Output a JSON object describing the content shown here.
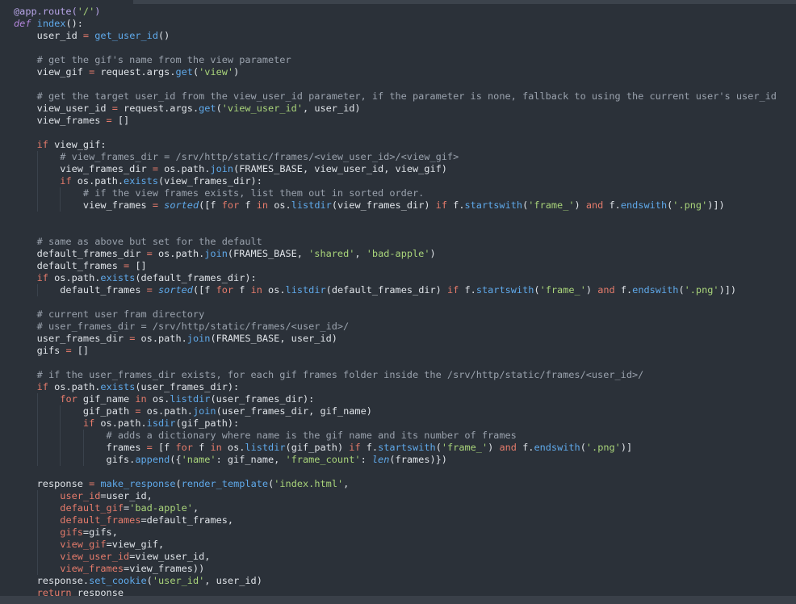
{
  "editor": {
    "language": "python",
    "colors": {
      "background": "#2b3139",
      "text": "#dfe3e8",
      "keyword": "#c678dd",
      "keyword_alt": "#e57b6b",
      "function": "#5fa9ea",
      "string": "#a9d47a",
      "comment": "#9aa2ad"
    },
    "lines": [
      [
        {
          "t": "@app.route(",
          "c": "t-dec"
        },
        {
          "t": "'/'",
          "c": "t-str"
        },
        {
          "t": ")",
          "c": "t-dec"
        }
      ],
      [
        {
          "t": "def",
          "c": "t-def"
        },
        {
          "t": " "
        },
        {
          "t": "index",
          "c": "t-fn"
        },
        {
          "t": "():"
        }
      ],
      [
        {
          "t": "    user_id "
        },
        {
          "t": "=",
          "c": "t-op"
        },
        {
          "t": " "
        },
        {
          "t": "get_user_id",
          "c": "t-fn"
        },
        {
          "t": "()"
        }
      ],
      [],
      [
        {
          "t": "    "
        },
        {
          "t": "# get the gif's name from the view parameter",
          "c": "t-cm"
        }
      ],
      [
        {
          "t": "    view_gif "
        },
        {
          "t": "=",
          "c": "t-op"
        },
        {
          "t": " request.args."
        },
        {
          "t": "get",
          "c": "t-fn"
        },
        {
          "t": "("
        },
        {
          "t": "'view'",
          "c": "t-str"
        },
        {
          "t": ")"
        }
      ],
      [],
      [
        {
          "t": "    "
        },
        {
          "t": "# get the target user_id from the view_user_id parameter, if the parameter is none, fallback to using the current user's user_id",
          "c": "t-cm"
        }
      ],
      [
        {
          "t": "    view_user_id "
        },
        {
          "t": "=",
          "c": "t-op"
        },
        {
          "t": " request.args."
        },
        {
          "t": "get",
          "c": "t-fn"
        },
        {
          "t": "("
        },
        {
          "t": "'view_user_id'",
          "c": "t-str"
        },
        {
          "t": ", user_id)"
        }
      ],
      [
        {
          "t": "    view_frames "
        },
        {
          "t": "=",
          "c": "t-op"
        },
        {
          "t": " []"
        }
      ],
      [],
      [
        {
          "t": "    "
        },
        {
          "t": "if",
          "c": "t-kw2"
        },
        {
          "t": " view_gif:"
        }
      ],
      [
        {
          "t": "        "
        },
        {
          "t": "# view_frames_dir = /srv/http/static/frames/<view_user_id>/<view_gif>",
          "c": "t-cm"
        }
      ],
      [
        {
          "t": "        view_frames_dir "
        },
        {
          "t": "=",
          "c": "t-op"
        },
        {
          "t": " os.path."
        },
        {
          "t": "join",
          "c": "t-fn"
        },
        {
          "t": "(FRAMES_BASE, view_user_id, view_gif)"
        }
      ],
      [
        {
          "t": "        "
        },
        {
          "t": "if",
          "c": "t-kw2"
        },
        {
          "t": " os.path."
        },
        {
          "t": "exists",
          "c": "t-fn"
        },
        {
          "t": "(view_frames_dir):"
        }
      ],
      [
        {
          "t": "            "
        },
        {
          "t": "# if the view frames exists, list them out in sorted order.",
          "c": "t-cm"
        }
      ],
      [
        {
          "t": "            view_frames "
        },
        {
          "t": "=",
          "c": "t-op"
        },
        {
          "t": " "
        },
        {
          "t": "sorted",
          "c": "t-bi"
        },
        {
          "t": "([f "
        },
        {
          "t": "for",
          "c": "t-kw2"
        },
        {
          "t": " f "
        },
        {
          "t": "in",
          "c": "t-kw2"
        },
        {
          "t": " os."
        },
        {
          "t": "listdir",
          "c": "t-fn"
        },
        {
          "t": "(view_frames_dir) "
        },
        {
          "t": "if",
          "c": "t-kw2"
        },
        {
          "t": " f."
        },
        {
          "t": "startswith",
          "c": "t-fn"
        },
        {
          "t": "("
        },
        {
          "t": "'frame_'",
          "c": "t-str"
        },
        {
          "t": ") "
        },
        {
          "t": "and",
          "c": "t-kw2"
        },
        {
          "t": " f."
        },
        {
          "t": "endswith",
          "c": "t-fn"
        },
        {
          "t": "("
        },
        {
          "t": "'.png'",
          "c": "t-str"
        },
        {
          "t": ")])"
        }
      ],
      [],
      [],
      [
        {
          "t": "    "
        },
        {
          "t": "# same as above but set for the default",
          "c": "t-cm"
        }
      ],
      [
        {
          "t": "    default_frames_dir "
        },
        {
          "t": "=",
          "c": "t-op"
        },
        {
          "t": " os.path."
        },
        {
          "t": "join",
          "c": "t-fn"
        },
        {
          "t": "(FRAMES_BASE, "
        },
        {
          "t": "'shared'",
          "c": "t-str"
        },
        {
          "t": ", "
        },
        {
          "t": "'bad-apple'",
          "c": "t-str"
        },
        {
          "t": ")"
        }
      ],
      [
        {
          "t": "    default_frames "
        },
        {
          "t": "=",
          "c": "t-op"
        },
        {
          "t": " []"
        }
      ],
      [
        {
          "t": "    "
        },
        {
          "t": "if",
          "c": "t-kw2"
        },
        {
          "t": " os.path."
        },
        {
          "t": "exists",
          "c": "t-fn"
        },
        {
          "t": "(default_frames_dir):"
        }
      ],
      [
        {
          "t": "        default_frames "
        },
        {
          "t": "=",
          "c": "t-op"
        },
        {
          "t": " "
        },
        {
          "t": "sorted",
          "c": "t-bi"
        },
        {
          "t": "([f "
        },
        {
          "t": "for",
          "c": "t-kw2"
        },
        {
          "t": " f "
        },
        {
          "t": "in",
          "c": "t-kw2"
        },
        {
          "t": " os."
        },
        {
          "t": "listdir",
          "c": "t-fn"
        },
        {
          "t": "(default_frames_dir) "
        },
        {
          "t": "if",
          "c": "t-kw2"
        },
        {
          "t": " f."
        },
        {
          "t": "startswith",
          "c": "t-fn"
        },
        {
          "t": "("
        },
        {
          "t": "'frame_'",
          "c": "t-str"
        },
        {
          "t": ") "
        },
        {
          "t": "and",
          "c": "t-kw2"
        },
        {
          "t": " f."
        },
        {
          "t": "endswith",
          "c": "t-fn"
        },
        {
          "t": "("
        },
        {
          "t": "'.png'",
          "c": "t-str"
        },
        {
          "t": ")])"
        }
      ],
      [],
      [
        {
          "t": "    "
        },
        {
          "t": "# current user fram directory",
          "c": "t-cm"
        }
      ],
      [
        {
          "t": "    "
        },
        {
          "t": "# user_frames_dir = /srv/http/static/frames/<user_id>/",
          "c": "t-cm"
        }
      ],
      [
        {
          "t": "    user_frames_dir "
        },
        {
          "t": "=",
          "c": "t-op"
        },
        {
          "t": " os.path."
        },
        {
          "t": "join",
          "c": "t-fn"
        },
        {
          "t": "(FRAMES_BASE, user_id)"
        }
      ],
      [
        {
          "t": "    gifs "
        },
        {
          "t": "=",
          "c": "t-op"
        },
        {
          "t": " []"
        }
      ],
      [],
      [
        {
          "t": "    "
        },
        {
          "t": "# if the user_frames_dir exists, for each gif frames folder inside the /srv/http/static/frames/<user_id>/",
          "c": "t-cm"
        }
      ],
      [
        {
          "t": "    "
        },
        {
          "t": "if",
          "c": "t-kw2"
        },
        {
          "t": " os.path."
        },
        {
          "t": "exists",
          "c": "t-fn"
        },
        {
          "t": "(user_frames_dir):"
        }
      ],
      [
        {
          "t": "        "
        },
        {
          "t": "for",
          "c": "t-kw2"
        },
        {
          "t": " gif_name "
        },
        {
          "t": "in",
          "c": "t-kw2"
        },
        {
          "t": " os."
        },
        {
          "t": "listdir",
          "c": "t-fn"
        },
        {
          "t": "(user_frames_dir):"
        }
      ],
      [
        {
          "t": "            gif_path "
        },
        {
          "t": "=",
          "c": "t-op"
        },
        {
          "t": " os.path."
        },
        {
          "t": "join",
          "c": "t-fn"
        },
        {
          "t": "(user_frames_dir, gif_name)"
        }
      ],
      [
        {
          "t": "            "
        },
        {
          "t": "if",
          "c": "t-kw2"
        },
        {
          "t": " os.path."
        },
        {
          "t": "isdir",
          "c": "t-fn"
        },
        {
          "t": "(gif_path):"
        }
      ],
      [
        {
          "t": "                "
        },
        {
          "t": "# adds a dictionary where name is the gif name and its number of frames",
          "c": "t-cm"
        }
      ],
      [
        {
          "t": "                frames "
        },
        {
          "t": "=",
          "c": "t-op"
        },
        {
          "t": " [f "
        },
        {
          "t": "for",
          "c": "t-kw2"
        },
        {
          "t": " f "
        },
        {
          "t": "in",
          "c": "t-kw2"
        },
        {
          "t": " os."
        },
        {
          "t": "listdir",
          "c": "t-fn"
        },
        {
          "t": "(gif_path) "
        },
        {
          "t": "if",
          "c": "t-kw2"
        },
        {
          "t": " f."
        },
        {
          "t": "startswith",
          "c": "t-fn"
        },
        {
          "t": "("
        },
        {
          "t": "'frame_'",
          "c": "t-str"
        },
        {
          "t": ") "
        },
        {
          "t": "and",
          "c": "t-kw2"
        },
        {
          "t": " f."
        },
        {
          "t": "endswith",
          "c": "t-fn"
        },
        {
          "t": "("
        },
        {
          "t": "'.png'",
          "c": "t-str"
        },
        {
          "t": ")]"
        }
      ],
      [
        {
          "t": "                gifs."
        },
        {
          "t": "append",
          "c": "t-fn"
        },
        {
          "t": "({"
        },
        {
          "t": "'name'",
          "c": "t-str"
        },
        {
          "t": ": gif_name, "
        },
        {
          "t": "'frame_count'",
          "c": "t-str"
        },
        {
          "t": ": "
        },
        {
          "t": "len",
          "c": "t-bi"
        },
        {
          "t": "(frames)})"
        }
      ],
      [],
      [
        {
          "t": "    response "
        },
        {
          "t": "=",
          "c": "t-op"
        },
        {
          "t": " "
        },
        {
          "t": "make_response",
          "c": "t-fn"
        },
        {
          "t": "("
        },
        {
          "t": "render_template",
          "c": "t-fn"
        },
        {
          "t": "("
        },
        {
          "t": "'index.html'",
          "c": "t-str"
        },
        {
          "t": ","
        }
      ],
      [
        {
          "t": "        "
        },
        {
          "t": "user_id",
          "c": "t-param"
        },
        {
          "t": "=user_id,"
        }
      ],
      [
        {
          "t": "        "
        },
        {
          "t": "default_gif",
          "c": "t-param"
        },
        {
          "t": "="
        },
        {
          "t": "'bad-apple'",
          "c": "t-str"
        },
        {
          "t": ","
        }
      ],
      [
        {
          "t": "        "
        },
        {
          "t": "default_frames",
          "c": "t-param"
        },
        {
          "t": "=default_frames,"
        }
      ],
      [
        {
          "t": "        "
        },
        {
          "t": "gifs",
          "c": "t-param"
        },
        {
          "t": "=gifs,"
        }
      ],
      [
        {
          "t": "        "
        },
        {
          "t": "view_gif",
          "c": "t-param"
        },
        {
          "t": "=view_gif,"
        }
      ],
      [
        {
          "t": "        "
        },
        {
          "t": "view_user_id",
          "c": "t-param"
        },
        {
          "t": "=view_user_id,"
        }
      ],
      [
        {
          "t": "        "
        },
        {
          "t": "view_frames",
          "c": "t-param"
        },
        {
          "t": "=view_frames))"
        }
      ],
      [
        {
          "t": "    response."
        },
        {
          "t": "set_cookie",
          "c": "t-fn"
        },
        {
          "t": "("
        },
        {
          "t": "'user_id'",
          "c": "t-str"
        },
        {
          "t": ", user_id)"
        }
      ],
      [
        {
          "t": "    "
        },
        {
          "t": "return",
          "c": "t-kw2"
        },
        {
          "t": " response"
        }
      ]
    ]
  }
}
